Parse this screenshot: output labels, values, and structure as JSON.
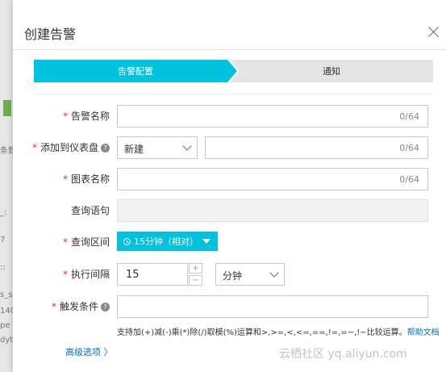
{
  "background": {
    "snippets": [
      "条数",
      "_:",
      "7",
      "::",
      "s_s",
      "140",
      "pe",
      "dyt"
    ]
  },
  "dialog": {
    "title": "创建告警"
  },
  "steps": {
    "step1": "告警配置",
    "step2": "通知"
  },
  "form": {
    "required_mark": "*",
    "alert_name": {
      "label": "告警名称",
      "count": "0/64"
    },
    "add_dashboard": {
      "label": "添加到仪表盘",
      "select_value": "新建",
      "count": "0/64"
    },
    "chart_name": {
      "label": "图表名称",
      "count": "0/64"
    },
    "query": {
      "label": "查询语句"
    },
    "query_range": {
      "label": "查询区间",
      "value": "15分钟（相对）"
    },
    "interval": {
      "label": "执行间隔",
      "value": "15",
      "plus": "+",
      "minus": "−",
      "unit": "分钟"
    },
    "trigger": {
      "label": "触发条件"
    },
    "help_glyph": "?"
  },
  "hint": {
    "text": "支持加(+)减(-)乘(*)除(/)取模(%)运算和>,>=,<,<=,==,!=,=~,!~比较运算。",
    "link": "帮助文档"
  },
  "advanced": "高级选项 〉",
  "watermark": "云栖社区 yq.aliyun.com",
  "colors": {
    "accent": "#00c1de",
    "link": "#0070cc",
    "required": "#e0303b"
  }
}
